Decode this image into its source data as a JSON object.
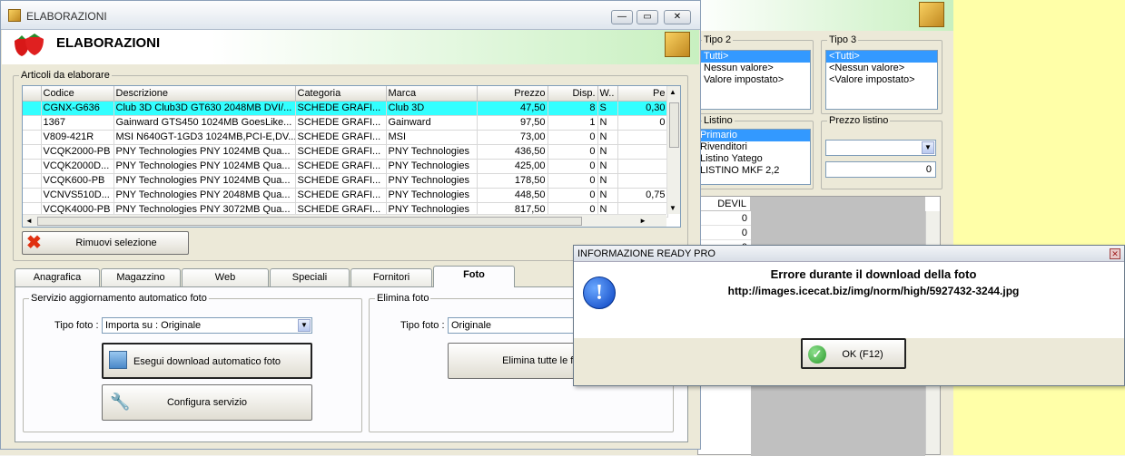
{
  "window": {
    "title": "ELABORAZIONI",
    "header": "ELABORAZIONI"
  },
  "articles": {
    "group_label": "Articoli da elaborare",
    "columns": [
      "Codice",
      "Descrizione",
      "Categoria",
      "Marca",
      "Prezzo",
      "Disp.",
      "W..",
      "Pe"
    ],
    "rows": [
      [
        "CGNX-G636",
        "Club 3D Club3D GT630 2048MB DVI/...",
        "SCHEDE GRAFI...",
        "Club 3D",
        "47,50",
        "8",
        "S",
        "0,30"
      ],
      [
        "1367",
        "Gainward GTS450 1024MB GoesLike...",
        "SCHEDE GRAFI...",
        "Gainward",
        "97,50",
        "1",
        "N",
        "0"
      ],
      [
        "V809-421R",
        "MSI N640GT-1GD3 1024MB,PCI-E,DV...",
        "SCHEDE GRAFI...",
        "MSI",
        "73,00",
        "0",
        "N",
        ""
      ],
      [
        "VCQK2000-PB",
        "PNY Technologies PNY 1024MB Qua...",
        "SCHEDE GRAFI...",
        "PNY Technologies",
        "436,50",
        "0",
        "N",
        ""
      ],
      [
        "VCQK2000D...",
        "PNY Technologies PNY 1024MB Qua...",
        "SCHEDE GRAFI...",
        "PNY Technologies",
        "425,00",
        "0",
        "N",
        ""
      ],
      [
        "VCQK600-PB",
        "PNY Technologies PNY 1024MB Qua...",
        "SCHEDE GRAFI...",
        "PNY Technologies",
        "178,50",
        "0",
        "N",
        ""
      ],
      [
        "VCNVS510D...",
        "PNY Technologies PNY 2048MB Qua...",
        "SCHEDE GRAFI...",
        "PNY Technologies",
        "448,50",
        "0",
        "N",
        "0,75"
      ],
      [
        "VCQK4000-PB",
        "PNY Technologies PNY 3072MB Qua...",
        "SCHEDE GRAFI...",
        "PNY Technologies",
        "817,50",
        "0",
        "N",
        ""
      ]
    ],
    "remove_button": "Rimuovi selezione"
  },
  "tabs": [
    "Anagrafica",
    "Magazzino",
    "Web",
    "Speciali",
    "Fornitori",
    "Foto"
  ],
  "active_tab": "Foto",
  "foto": {
    "auto_group": "Servizio aggiornamento automatico foto",
    "tipo_label": "Tipo foto :",
    "tipo_value": "Importa su : Originale",
    "download_button": "Esegui download automatico foto",
    "config_button": "Configura servizio",
    "elimina_group": "Elimina foto",
    "elimina_tipo_label": "Tipo foto :",
    "elimina_tipo_value": "Originale",
    "elimina_button": "Elimina tutte le foto del ti"
  },
  "bg": {
    "tipo2_label": "Tipo 2",
    "tipo2_items": [
      "Tutti>",
      "Nessun valore>",
      "Valore impostato>"
    ],
    "tipo3_label": "Tipo 3",
    "tipo3_items": [
      "<Tutti>",
      "<Nessun valore>",
      "<Valore impostato>"
    ],
    "listino_label": "Listino",
    "listino_items": [
      "Primario",
      "Rivenditori",
      "Listino Yatego",
      "LISTINO MKF 2,2"
    ],
    "prezzo_label": "Prezzo listino",
    "prezzo_value": "0",
    "devil_header": "DEVIL",
    "devil_values": [
      "0",
      "0",
      "0"
    ]
  },
  "dialog": {
    "title": "INFORMAZIONE READY PRO",
    "message_line1": "Errore durante il download della foto",
    "message_line2": "http://images.icecat.biz/img/norm/high/5927432-3244.jpg",
    "ok_button": "OK (F12)"
  }
}
